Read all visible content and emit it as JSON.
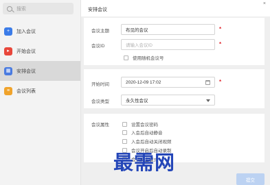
{
  "sidebar": {
    "search_placeholder": "搜索",
    "items": [
      {
        "label": "加入会议",
        "icon": "join-meeting-icon",
        "color": "#3b7ce8"
      },
      {
        "label": "开始会议",
        "icon": "start-meeting-icon",
        "color": "#e8473b"
      },
      {
        "label": "安排会议",
        "icon": "schedule-meeting-icon",
        "color": "#4a7be0"
      },
      {
        "label": "会议列表",
        "icon": "meeting-list-icon",
        "color": "#f0a32b"
      }
    ]
  },
  "main": {
    "title": "安排会议",
    "form": {
      "subject_label": "会议主题",
      "subject_value": "布见的会议",
      "id_label": "会议ID",
      "id_placeholder": "请输入会议ID",
      "random_id_label": "使用随机会议号",
      "start_time_label": "开始时间",
      "start_time_value": "2020-12-09 17:02",
      "type_label": "会议类型",
      "type_value": "永久性会议",
      "attributes_label": "会议属性",
      "attributes": [
        "设置会议密码",
        "入会后自动静音",
        "入会后自动关闭视频",
        "会议开启后自动录制",
        "会议安全模式"
      ]
    },
    "submit_label": "提交"
  },
  "watermark": "最需网",
  "colors": {
    "required": "#e0262d",
    "submit_bg": "#bcd2f2",
    "active_nav": "#d9d9d9"
  }
}
